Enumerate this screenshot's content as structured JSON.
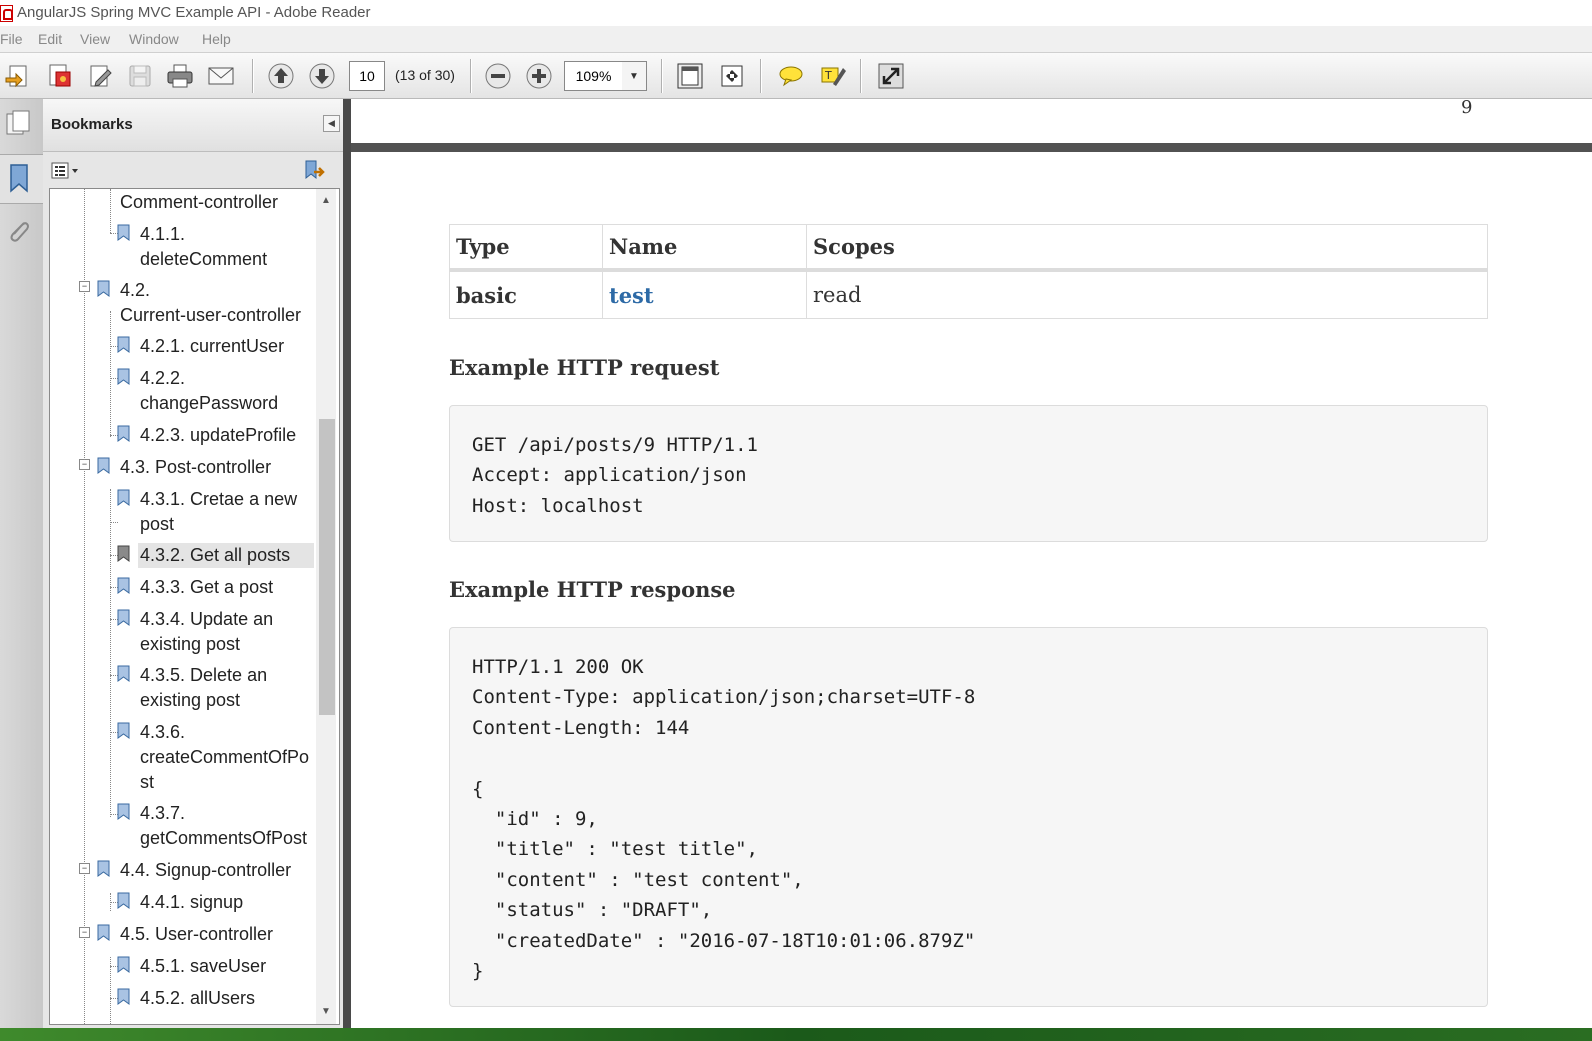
{
  "window": {
    "title": "AngularJS Spring MVC Example API - Adobe Reader"
  },
  "menu": [
    "File",
    "Edit",
    "View",
    "Window",
    "Help"
  ],
  "toolbar": {
    "page_number": "10",
    "page_count": "(13 of 30)",
    "zoom": "109%"
  },
  "bookmarks": {
    "title": "Bookmarks",
    "items": [
      {
        "label": "Comment-controller",
        "level": 1
      },
      {
        "label": "4.1.1.",
        "label2": "deleteComment",
        "level": 2
      },
      {
        "label": "4.2.",
        "label2": "Current-user-controller",
        "level": 1
      },
      {
        "label": "4.2.1. currentUser",
        "level": 2
      },
      {
        "label": "4.2.2.",
        "label2": "changePassword",
        "level": 2
      },
      {
        "label": "4.2.3. updateProfile",
        "level": 2
      },
      {
        "label": "4.3. Post-controller",
        "level": 1
      },
      {
        "label": "4.3.1. Cretae a new",
        "label2": "post",
        "level": 2
      },
      {
        "label": "4.3.2. Get all posts",
        "level": 2,
        "selected": true
      },
      {
        "label": "4.3.3. Get a post",
        "level": 2
      },
      {
        "label": "4.3.4. Update an",
        "label2": "existing post",
        "level": 2
      },
      {
        "label": "4.3.5. Delete an",
        "label2": "existing post",
        "level": 2
      },
      {
        "label": "4.3.6.",
        "label2": "createCommentOfPo",
        "label3": "st",
        "level": 2
      },
      {
        "label": "4.3.7.",
        "label2": "getCommentsOfPost",
        "level": 2
      },
      {
        "label": "4.4. Signup-controller",
        "level": 1
      },
      {
        "label": "4.4.1. signup",
        "level": 2
      },
      {
        "label": "4.5. User-controller",
        "level": 1
      },
      {
        "label": "4.5.1. saveUser",
        "level": 2
      },
      {
        "label": "4.5.2. allUsers",
        "level": 2
      }
    ]
  },
  "document": {
    "prev_page_number": "9",
    "security_table": {
      "headers": [
        "Type",
        "Name",
        "Scopes"
      ],
      "row": [
        "basic",
        "test",
        "read"
      ]
    },
    "request_heading": "Example HTTP request",
    "request_code": "GET /api/posts/9 HTTP/1.1\nAccept: application/json\nHost: localhost",
    "response_heading": "Example HTTP response",
    "response_code": "HTTP/1.1 200 OK\nContent-Type: application/json;charset=UTF-8\nContent-Length: 144\n\n{\n  \"id\" : 9,\n  \"title\" : \"test title\",\n  \"content\" : \"test content\",\n  \"status\" : \"DRAFT\",\n  \"createdDate\" : \"2016-07-18T10:01:06.879Z\"\n}"
  }
}
